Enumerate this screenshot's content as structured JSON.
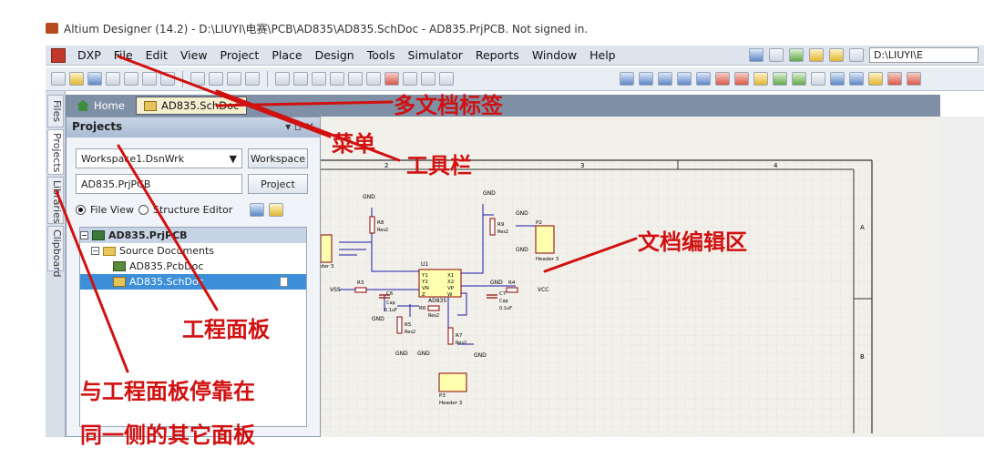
{
  "window": {
    "title": "Altium Designer (14.2) - D:\\LIUYI\\电赛\\PCB\\AD835\\AD835.SchDoc - AD835.PrjPCB. Not signed in."
  },
  "menu": {
    "dxp": "DXP",
    "items": [
      "File",
      "Edit",
      "View",
      "Project",
      "Place",
      "Design",
      "Tools",
      "Simulator",
      "Reports",
      "Window",
      "Help"
    ],
    "path": "D:\\LIUYI\\E"
  },
  "tabs": {
    "home": "Home",
    "doc": "AD835.SchDoc"
  },
  "side_tabs": [
    "Files",
    "Projects",
    "Libraries",
    "Clipboard"
  ],
  "panel": {
    "title": "Projects",
    "header_buttons": "▾ ▫ ✕",
    "workspace_value": "Workspace1.DsnWrk",
    "workspace_button": "Workspace",
    "project_value": "AD835.PrjPCB",
    "project_button": "Project",
    "radio_file_view": "File View",
    "radio_structure": "Structure Editor",
    "tree": {
      "project": "AD835.PrjPCB",
      "folder": "Source Documents",
      "pcb": "AD835.PcbDoc",
      "sch": "AD835.SchDoc"
    }
  },
  "schematic": {
    "col_labels": [
      "2",
      "3",
      "4"
    ],
    "row_labels": [
      "A",
      "B"
    ],
    "gnd": "GND",
    "vss": "VSS",
    "vcc": "VCC",
    "u1": "U1",
    "u1_part": "AD835",
    "u1_pins_left": [
      "Y1",
      "Y2",
      "VN",
      "Z"
    ],
    "u1_pins_right": [
      "X1",
      "X2",
      "VP",
      "W"
    ],
    "r_labels": [
      "R8",
      "R9",
      "R3",
      "R4",
      "R6",
      "R5",
      "R7"
    ],
    "c_labels": [
      "C6",
      "C7"
    ],
    "res_text": "Res2",
    "cap_text": "Cap",
    "cap_val": "0.1uF",
    "p_labels": [
      "P2",
      "P3"
    ],
    "header3": "Header 3",
    "ders": "der 3"
  },
  "annotations": {
    "multi_doc_tabs": "多文档标签",
    "menu": "菜单",
    "toolbar": "工具栏",
    "editor": "文档编辑区",
    "project_panel": "工程面板",
    "other_panels_1": "与工程面板停靠在",
    "other_panels_2": "同一侧的其它面板"
  },
  "colors": {
    "annotation": "#d11010",
    "tab_bar": "#7f8fa6",
    "selection": "#3c8fd8"
  }
}
